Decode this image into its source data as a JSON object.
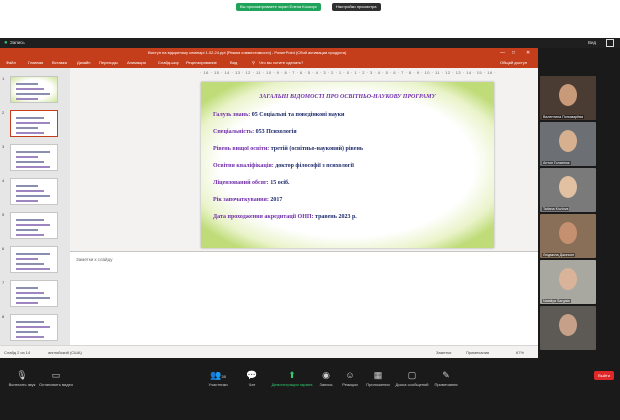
{
  "zoom": {
    "banner_view": "Вы просматриваете экран Елена Козачук",
    "banner_options": "Настройки просмотра",
    "record_label": "Запись",
    "view_label": "Вид"
  },
  "ppt": {
    "window_title": "Виступ на відкритому семінарі 1.02.24.ppt [Режим совместимости] - PowerPoint (Сбой активации продукта)",
    "tabs": [
      "Файл",
      "Главная",
      "Вставка",
      "Дизайн",
      "Переходы",
      "Анимация",
      "Слайд-шоу",
      "Рецензирование",
      "Вид"
    ],
    "search_hint": "Что вы хотите сделать?",
    "share_label": "Общий доступ",
    "ruler": "· 16 · 15 · 14 · 13 · 12 · 11 · 10 · 9 · 8 · 7 · 6 · 5 · 4 · 3 · 2 · 1 · 0 · 1 · 2 · 3 · 4 · 5 · 6 · 7 · 8 · 9 · 10 · 11 · 12 · 13 · 14 · 15 · 16 ·",
    "thumbnails": [
      {
        "num": "1"
      },
      {
        "num": "2"
      },
      {
        "num": "3"
      },
      {
        "num": "4"
      },
      {
        "num": "5"
      },
      {
        "num": "6"
      },
      {
        "num": "7"
      },
      {
        "num": "8"
      },
      {
        "num": "9"
      }
    ],
    "slide": {
      "title": "ЗАГАЛЬНІ ВІДОМОСТІ ПРО ОСВІТНЬО-НАУКОВУ ПРОГРАМУ",
      "rows": [
        {
          "key": "Галузь знань:",
          "value": "05 Соціальні та поведінкові науки"
        },
        {
          "key": "Спеціальність:",
          "value": "053 Психологія"
        },
        {
          "key": "Рівень вищої освіти:",
          "value": "третій (освітньо-науковий) рівень"
        },
        {
          "key": "Освітня кваліфікація:",
          "value": "доктор філософії з психології"
        },
        {
          "key": "Ліцензований обсяг:",
          "value": "15 осіб."
        },
        {
          "key": "Рік започаткування:",
          "value": "2017"
        },
        {
          "key": "Дата проходження акредитації ОНП:",
          "value": "травень 2023 р."
        }
      ]
    },
    "notes_placeholder": "Заметки к слайду",
    "status_slide": "Слайд 2 из 14",
    "status_lang": "английский (США)",
    "status_notes": "Заметки",
    "status_comments": "Примечания",
    "status_zoom": "67%"
  },
  "participants": [
    {
      "name": "Валентина Пономарёва"
    },
    {
      "name": "Антон Голатнюк"
    },
    {
      "name": "Tatiana Kozlova"
    },
    {
      "name": "Людмила Джонсон"
    },
    {
      "name": "Nataliya Sargata"
    },
    {
      "name": ""
    }
  ],
  "controls": {
    "unmute": "Включить звук",
    "video": "Остановить видео",
    "participants": "Участники",
    "participants_count": "38",
    "chat": "Чат",
    "share": "Демонстрация экрана",
    "record": "Запись",
    "reactions": "Реакции",
    "apps": "Приложения",
    "whiteboard": "Доска сообщений",
    "notes": "Примечания",
    "leave": "Выйти"
  }
}
